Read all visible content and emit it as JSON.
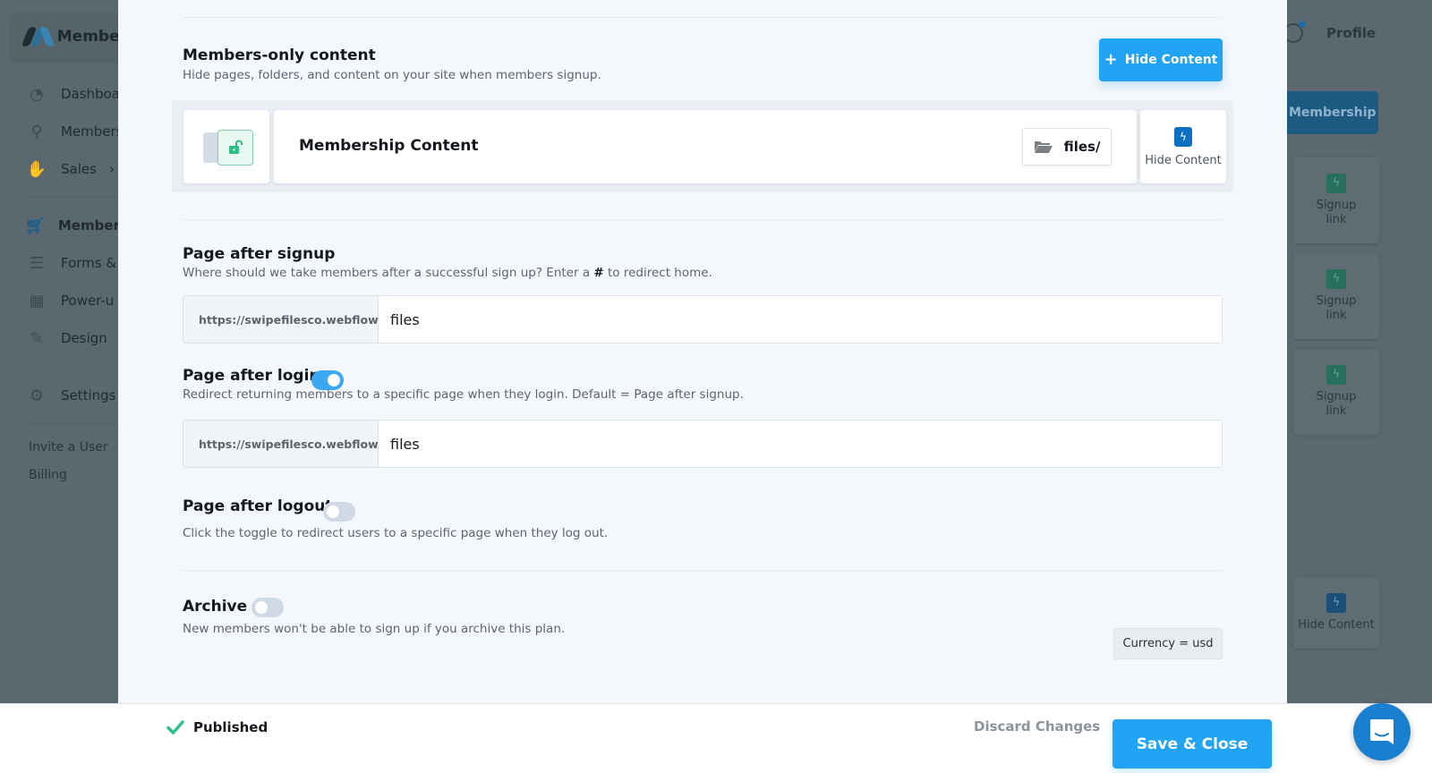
{
  "background": {
    "brand_name": "Member",
    "nav": [
      {
        "label": "Dashboa",
        "icon": "dashboard-icon"
      },
      {
        "label": "Members",
        "icon": "members-icon"
      },
      {
        "label": "Sales",
        "icon": "sales-icon",
        "chevron": "›"
      },
      {
        "label": "Members",
        "icon": "cart-icon",
        "active": true
      },
      {
        "label": "Forms &",
        "icon": "forms-icon"
      },
      {
        "label": "Power-u",
        "icon": "powerups-icon"
      },
      {
        "label": "Design",
        "icon": "brush-icon"
      },
      {
        "label": "Settings",
        "icon": "gear-icon"
      }
    ],
    "sub_links": [
      "Invite a User",
      "Billing"
    ],
    "profile_label": "Profile",
    "membership_tab": "Membership",
    "right_cards": [
      {
        "label": "Signup link",
        "icon": "bolt-icon"
      },
      {
        "label": "Signup link",
        "icon": "bolt-icon"
      },
      {
        "label": "Signup link",
        "icon": "bolt-icon"
      },
      {
        "label": "Hide Content",
        "icon": "bolt-icon"
      }
    ]
  },
  "modal": {
    "members_only": {
      "title": "Members-only content",
      "description": "Hide pages, folders, and content on your site when members signup.",
      "hide_button": "Hide Content",
      "hide_button_icon": "+",
      "item": {
        "name": "Membership Content",
        "folder_label": "files/",
        "action_label": "Hide Content"
      }
    },
    "page_after_signup": {
      "title": "Page after signup",
      "description_before": "Where should we take members after a successful sign up? Enter a ",
      "description_symbol": "#",
      "description_after": " to redirect home.",
      "url_prefix": "https://swipefilesco.webflow.io/",
      "value": "files"
    },
    "page_after_login": {
      "title": "Page after login",
      "toggle_on": true,
      "description": "Redirect returning members to a specific page when they login. Default = Page after signup.",
      "url_prefix": "https://swipefilesco.webflow.io/",
      "value": "files"
    },
    "page_after_logout": {
      "title": "Page after logout",
      "toggle_on": false,
      "description": "Click the toggle to redirect users to a specific page when they log out."
    },
    "archive": {
      "title": "Archive",
      "toggle_on": false,
      "description": "New members won't be able to sign up if you archive this plan."
    },
    "currency": "Currency = usd"
  },
  "footer": {
    "status": "Published",
    "discard": "Discard Changes",
    "save": "Save & Close"
  },
  "colors": {
    "primary": "#21a4f3",
    "success": "#2fbf85",
    "toggle_on": "#3ba8f1",
    "toggle_off": "#cfdae6"
  }
}
